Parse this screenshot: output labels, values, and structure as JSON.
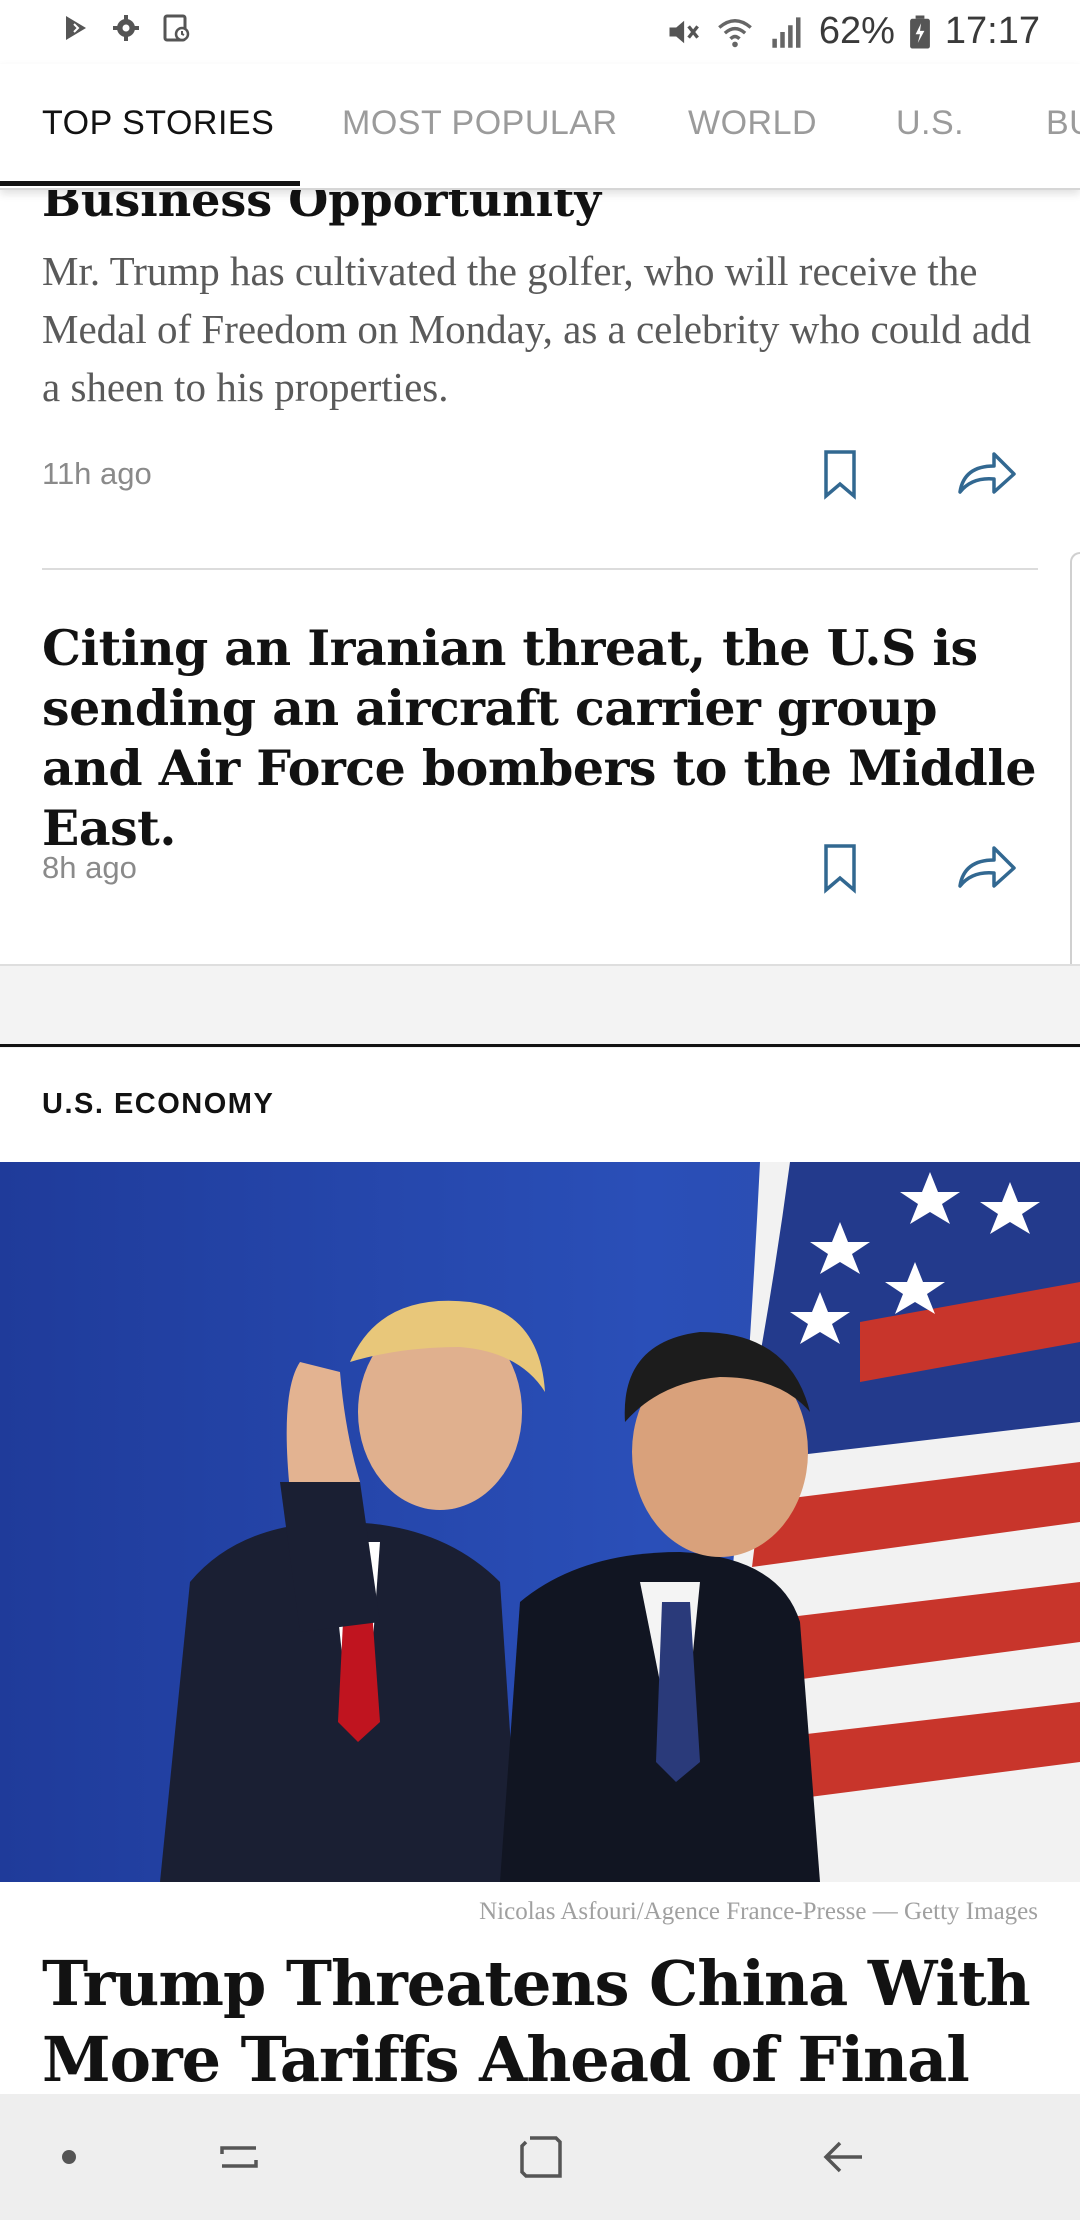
{
  "status_bar": {
    "battery": "62%",
    "time": "17:17",
    "icons": [
      "play-store-icon",
      "settings-notification-icon",
      "screen-record-icon",
      "mute-icon",
      "wifi-icon",
      "signal-icon",
      "battery-icon"
    ]
  },
  "tabs": [
    {
      "label": "TOP STORIES",
      "active": true
    },
    {
      "label": "MOST POPULAR",
      "active": false
    },
    {
      "label": "WORLD",
      "active": false
    },
    {
      "label": "U.S.",
      "active": false
    },
    {
      "label": "BU",
      "active": false
    }
  ],
  "articles": [
    {
      "headline": "Business Opportunity",
      "summary": "Mr. Trump has cultivated the golfer, who will receive the Medal of Freedom on Monday, as a celebrity who could add a sheen to his properties.",
      "time": "11h ago"
    },
    {
      "headline": "Citing an Iranian threat, the U.S is sending an aircraft carrier group and Air Force bombers to the Middle East.",
      "time": "8h ago"
    }
  ],
  "section": {
    "title": "U.S. ECONOMY",
    "photo_credit": "Nicolas Asfouri/Agence France-Presse — Getty Images",
    "headline": "Trump Threatens China With More Tariffs Ahead of Final Trade"
  },
  "colors": {
    "accent": "#326891",
    "text": "#121212",
    "muted": "#8a8a8a"
  }
}
